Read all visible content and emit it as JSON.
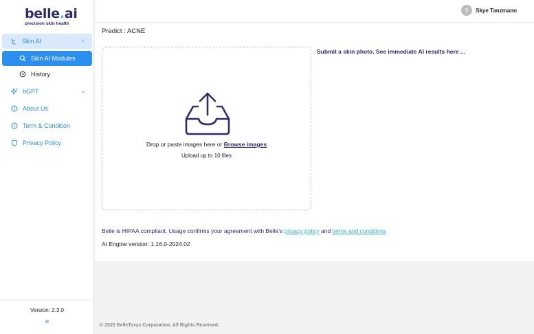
{
  "brand": {
    "name_part1": "belle",
    "name_dot": ".",
    "name_part2": "ai",
    "tagline": "precision skin health"
  },
  "sidebar": {
    "items": [
      {
        "label": "Skin AI",
        "icon": "skin-icon"
      },
      {
        "label": "Skin AI Modules",
        "icon": "search-icon"
      },
      {
        "label": "History",
        "icon": "history-icon"
      },
      {
        "label": "bGPT",
        "icon": "sparkle-icon"
      },
      {
        "label": "About Us",
        "icon": "info-icon"
      },
      {
        "label": "Term & Condition",
        "icon": "info-icon"
      },
      {
        "label": "Privacy Policy",
        "icon": "shield-icon"
      }
    ],
    "version": "Version: 2.3.0",
    "collapse_glyph": "«"
  },
  "topbar": {
    "avatar_initial": "S",
    "user_name": "Skye Tanzmann"
  },
  "main": {
    "predict_label": "Predict : ACNE",
    "drop_text": "Drop or paste images here or",
    "browse_label": "Browse images",
    "upload_limit": "Upload up to 10 files",
    "results_heading": "Submit a skin photo. See immediate AI results here ...",
    "hipaa_prefix": "Belle is HIPAA compliant. Usage confirms your agreement with Belle's",
    "privacy_link": "privacy policy",
    "and_text": "and",
    "terms_link": "terms and conditions",
    "engine_version": "AI Engine version: 1.16.0-2024.02"
  },
  "footer": {
    "copyright": "© 2025 BelleTorus Corporation. All Rights Reserved."
  },
  "colors": {
    "brand": "#2d2a6e",
    "accent": "#2b8ff0",
    "link": "#2bb3c9",
    "active_bg": "#d9e9fb"
  }
}
